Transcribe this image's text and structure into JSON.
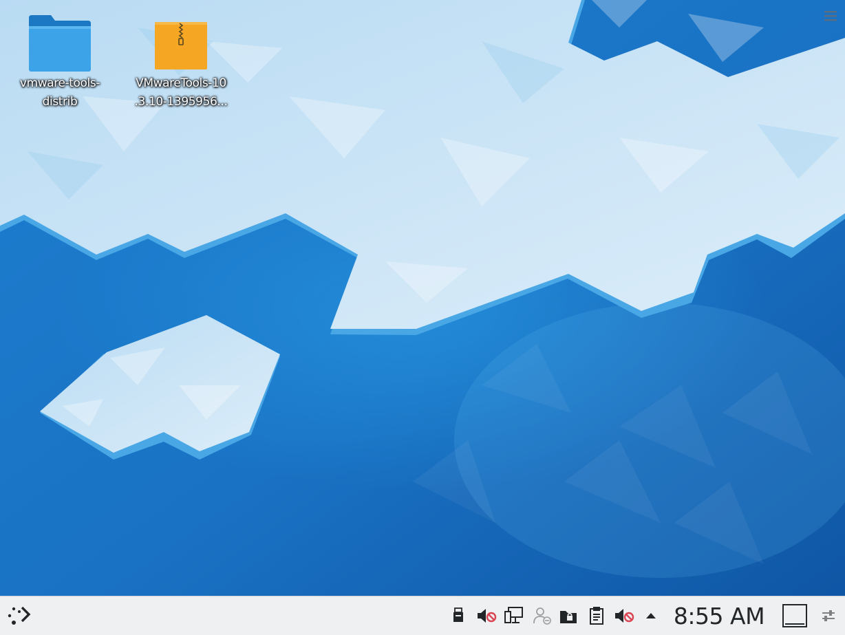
{
  "desktop": {
    "icons": [
      {
        "name": "folder",
        "label_line1": "vmware-tools-",
        "label_line2": "distrib"
      },
      {
        "name": "archive",
        "label_line1": "VMwareTools-10",
        "label_line2": ".3.10-1395956..."
      }
    ],
    "toolbox_icon": "hamburger-menu-icon"
  },
  "taskbar": {
    "launcher_icon": "application-launcher-icon",
    "tray_icons": [
      "usb-device-icon",
      "audio-muted-icon",
      "network-disconnected-icon",
      "user-status-icon",
      "vault-icon",
      "clipboard-icon",
      "audio-muted-icon",
      "expand-arrow-icon"
    ],
    "clock": "8:55 AM",
    "show_desktop_icon": "show-desktop-icon",
    "panel_settings_icon": "panel-settings-icon"
  },
  "colors": {
    "accent": "#1a6fc0",
    "panel": "#eff0f1",
    "folder": "#3da3e8",
    "archive": "#f5a623",
    "mute_red": "#da4453"
  }
}
